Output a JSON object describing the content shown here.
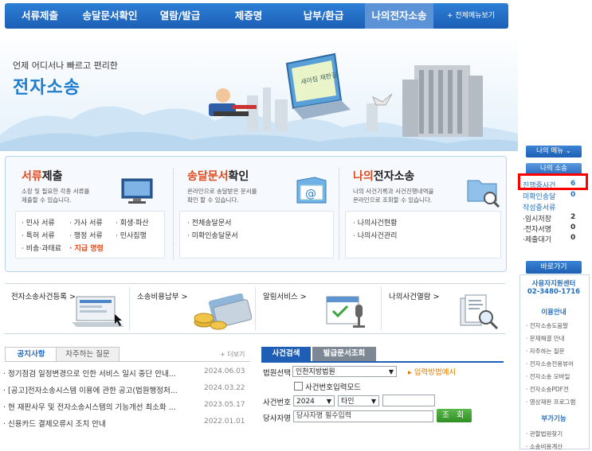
{
  "nav": {
    "items": [
      "서류제출",
      "송달문서확인",
      "열람/발급",
      "제증명",
      "납부/환급",
      "나의전자소송"
    ],
    "all_menu": "+ 전체메뉴보기"
  },
  "hero": {
    "tagline": "언제 어디서나 빠르고 편리한",
    "title": "전자소송",
    "sign_text": "새아침 재판길"
  },
  "services": {
    "submit": {
      "title_red": "서류",
      "title_rest": "제출",
      "desc1": "소장 및 필요한 각종 서류를",
      "desc2": "제출할 수 있습니다.",
      "links": [
        "· 민사 서류",
        "· 가사 서류",
        "· 회생·파산",
        "· 특허 서류",
        "· 행정 서류",
        "· 민사집행",
        "· 비송·과태료",
        "· 지급 명령"
      ]
    },
    "delivery": {
      "title_red": "송달문서",
      "title_rest": "확인",
      "desc1": "온라인으로 송달받은 문서를",
      "desc2": "확인 할 수 있습니다.",
      "links": [
        "· 전체송달문서",
        "· 미확인송달문서"
      ]
    },
    "mycase": {
      "title_red": "나의",
      "title_rest": "전자소송",
      "desc1": "나의 사건기록과 사건진행내역을",
      "desc2": "온라인으로 조회할 수 있습니다.",
      "links": [
        "· 나의사건현황",
        "· 나의사건관리"
      ]
    }
  },
  "quick": [
    "전자소송사건등록 >",
    "소송비용납부 >",
    "알림서비스 >",
    "나의사건열람 >"
  ],
  "notice": {
    "tab_active": "공지사항",
    "tab_inactive": "자주하는 질문",
    "more": "+ 더보기",
    "rows": [
      {
        "text": "· 정기점검 일정변경으로 인한 서비스 일시 중단 안내...",
        "date": "2024.06.03"
      },
      {
        "text": "· [공고]전자소송시스템 이용에 관한 공고(법원행정처...",
        "date": "2024.03.22"
      },
      {
        "text": "· 현 재판사무 및 전자소송시스템의 기능개선 최소화 ...",
        "date": "2023.05.17"
      },
      {
        "text": "· 신용카드 결제오류시 조치 안내",
        "date": "2022.01.01"
      }
    ]
  },
  "case_search": {
    "tab_active": "사건검색",
    "tab_inactive": "발급문서조회",
    "court_label": "법원선택",
    "court_value": "인천지방법원",
    "input_method": "▸ 입력방법예시",
    "checkbox_label": "사건번호입력모드",
    "caseno_label": "사건번호",
    "year_value": "2024",
    "type_value": "타인",
    "party_label": "당사자명",
    "party_placeholder": "당사자명 필수입력",
    "search_button": "조 회"
  },
  "sidebar": {
    "my_menu": "나의 메뉴 ⌄",
    "my_lawsuit": "나의 소송",
    "items": [
      {
        "label": "진행중사건",
        "count": "6"
      },
      {
        "label": "미확인송달",
        "count": "0"
      },
      {
        "label": "작성중서류",
        "count": ""
      },
      {
        "label": "·임시저장",
        "count": "2"
      },
      {
        "label": "·전자서명",
        "count": "0"
      },
      {
        "label": "·제출대기",
        "count": "0"
      }
    ],
    "goto": "바로가기",
    "support_center": "사용자지원센터",
    "phone": "02-3480-1716",
    "usage_head": "이용안내",
    "usage_links": [
      "· 전자소송도움말",
      "· 문제해결 안내",
      "· 자주하는 질문",
      "· 전자소송전용뷰어",
      "· 전자소송 모바일",
      "· 전자소송PDF전",
      "· 영상재판 프로그램"
    ],
    "extra_head": "부가기능",
    "extra_links": [
      "· 관할법원찾기",
      "· 소송비용계산"
    ]
  },
  "colors": {
    "nav_blue": "#1c5fb5",
    "accent_red": "#e0491b",
    "link_blue": "#1f6fc2",
    "highlight": "#ff0000",
    "search_green": "#3a9a2c"
  }
}
